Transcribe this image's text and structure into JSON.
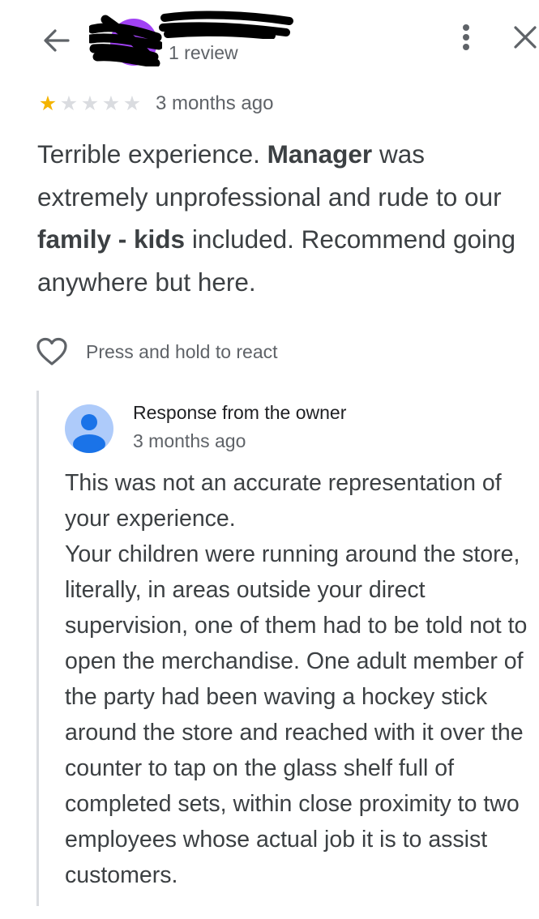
{
  "header": {
    "back_icon": "arrow-left-icon",
    "reviewer_meta": "1 review",
    "more_icon": "more-vertical-icon",
    "close_icon": "close-icon"
  },
  "review": {
    "rating": 1,
    "max_rating": 5,
    "time": "3 months ago",
    "text_segments": [
      {
        "text": "Terrible experience. ",
        "bold": false
      },
      {
        "text": "Manager",
        "bold": true
      },
      {
        "text": " was extremely unprofessional and rude to our ",
        "bold": false
      },
      {
        "text": "family - kids",
        "bold": true
      },
      {
        "text": " included. Recommend going anywhere but here.",
        "bold": false
      }
    ]
  },
  "reaction": {
    "icon": "heart-outline-icon",
    "label": "Press and hold to react"
  },
  "owner_response": {
    "avatar_icon": "person-avatar-icon",
    "title": "Response from the owner",
    "time": "3 months ago",
    "text": "This was not an accurate representation of your experience.\nYour children were running around the store, literally, in areas outside your direct supervision, one of them had to be told not to open the merchandise. One adult member of the party had been waving a hockey stick around the store and reached with it over the counter to tap on the glass shelf full of completed sets, within close proximity to two employees whose actual job it is to assist customers."
  },
  "colors": {
    "star_filled": "#f4b400",
    "star_empty": "#dadce0",
    "text_primary": "#3c4043",
    "text_secondary": "#5f6368",
    "owner_avatar_bg": "#aecbfa",
    "owner_avatar_fg": "#1a73e8",
    "redaction": "#000000",
    "profile_purple": "#a142f4"
  }
}
